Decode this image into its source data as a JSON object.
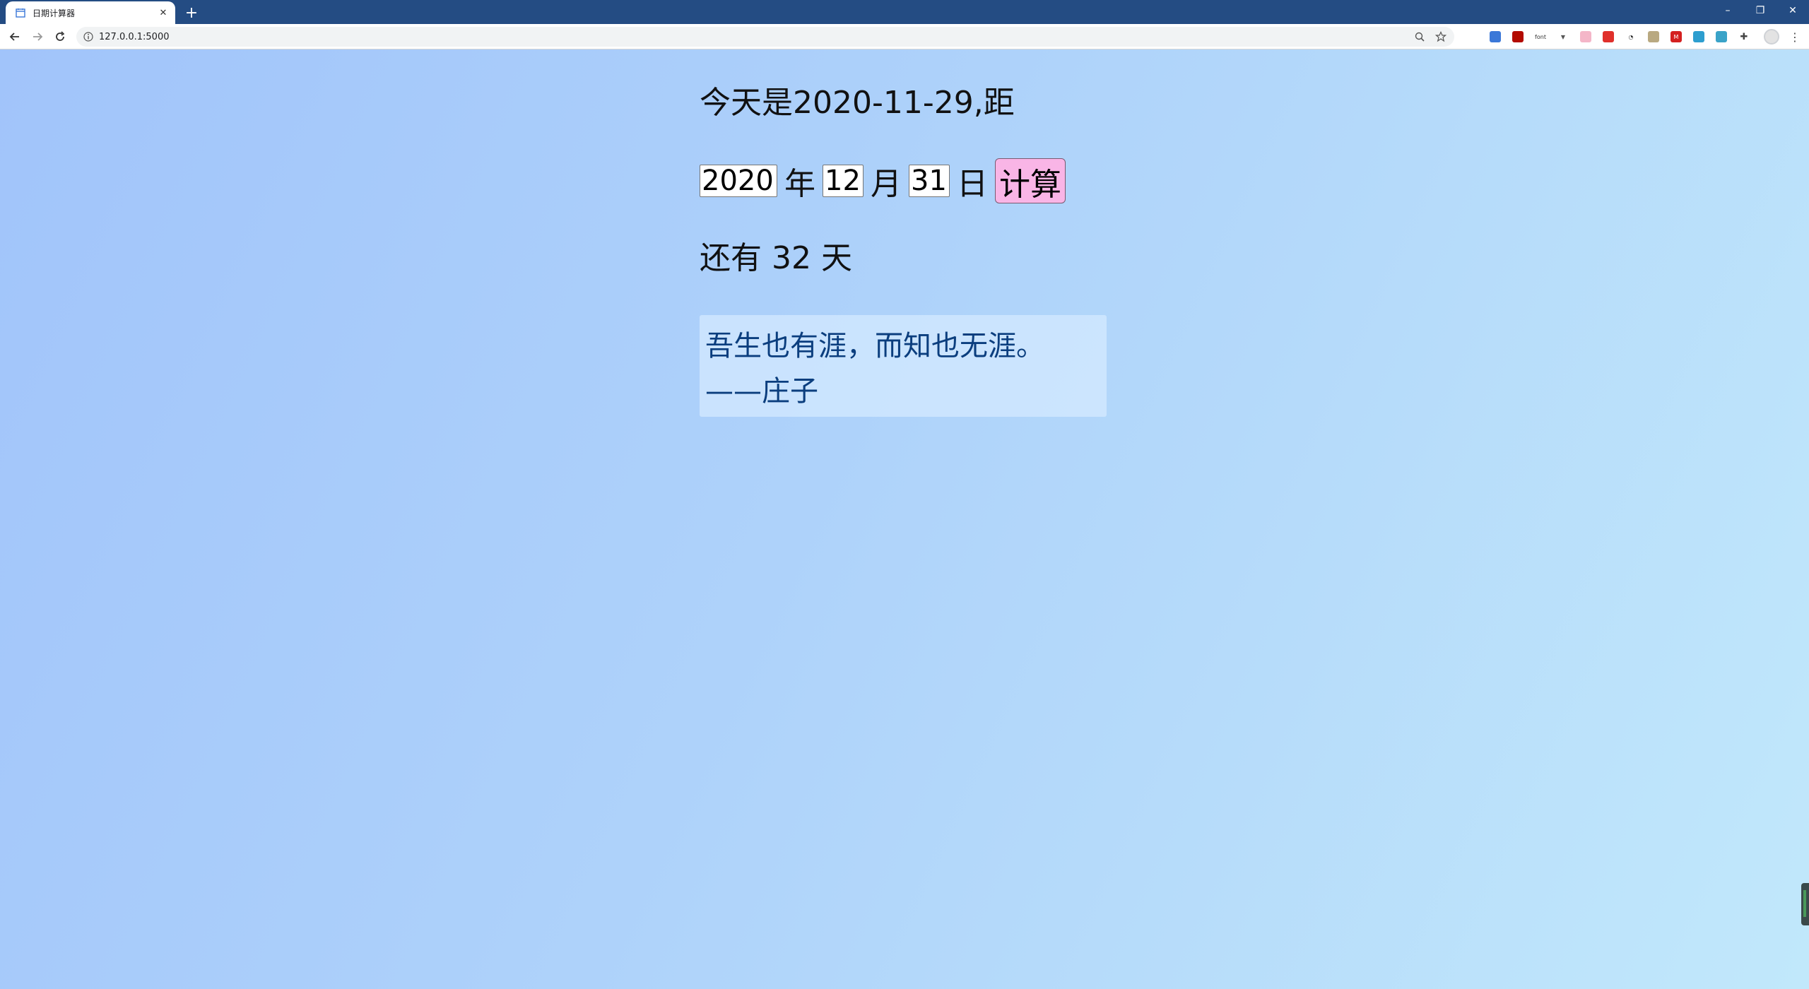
{
  "browser": {
    "tab": {
      "title": "日期计算器",
      "favicon": "calendar-icon",
      "close": "✕"
    },
    "new_tab": "+",
    "window_controls": {
      "minimize": "–",
      "maximize": "❐",
      "close": "✕"
    },
    "url": "127.0.0.1:5000",
    "extensions": [
      "puzzle-piece-icon",
      "pdf-icon",
      "font-icon",
      "v-icon",
      "pink-icon",
      "red-icon",
      "gauge-icon",
      "image-icon",
      "m-icon",
      "shield-icon",
      "note-icon"
    ]
  },
  "page": {
    "today_text": "今天是2020-11-29,距",
    "form": {
      "year_value": "2020",
      "year_unit": "年",
      "month_value": "12",
      "month_unit": "月",
      "day_value": "31",
      "day_unit": "日",
      "calc_label": "计算"
    },
    "result": {
      "prefix": "还有",
      "days": "32",
      "suffix": "天"
    },
    "quote": {
      "line1": "吾生也有涯，而知也无涯。",
      "line2": "——庄子"
    }
  },
  "colors": {
    "titlebar": "#244c83",
    "calc_button": "#f9b5e6",
    "quote_text": "#0b3e7e"
  }
}
